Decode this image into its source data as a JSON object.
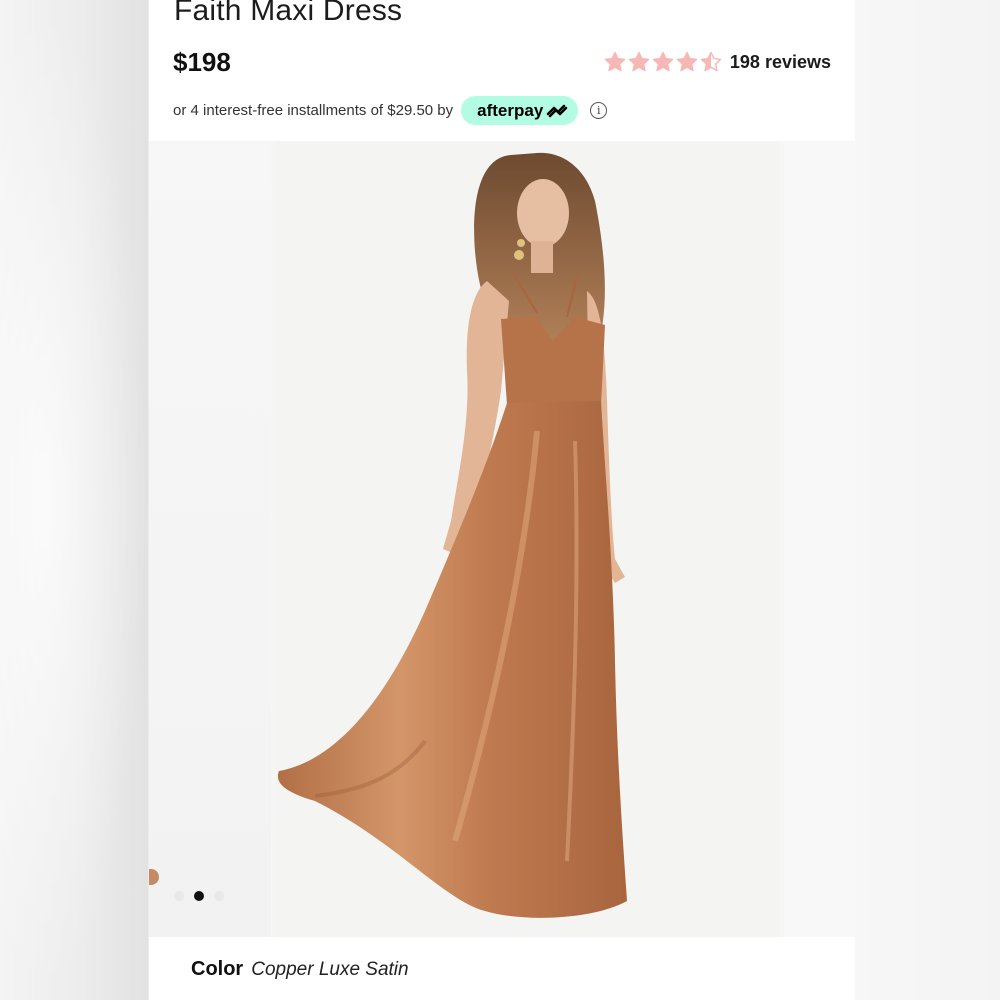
{
  "product": {
    "title": "Faith Maxi Dress",
    "price": "$198"
  },
  "rating": {
    "value": 4.5,
    "max": 5,
    "star_color": "#f6b8b4",
    "reviews_label": "198 reviews"
  },
  "installments": {
    "text": "or 4 interest-free installments of $29.50 by",
    "provider": "afterpay",
    "badge_color": "#b2fce4",
    "info_symbol": "i"
  },
  "gallery": {
    "slide_count": 3,
    "active_index": 1,
    "dress_color": "#c4825a"
  },
  "color": {
    "label": "Color",
    "value": "Copper Luxe Satin"
  }
}
